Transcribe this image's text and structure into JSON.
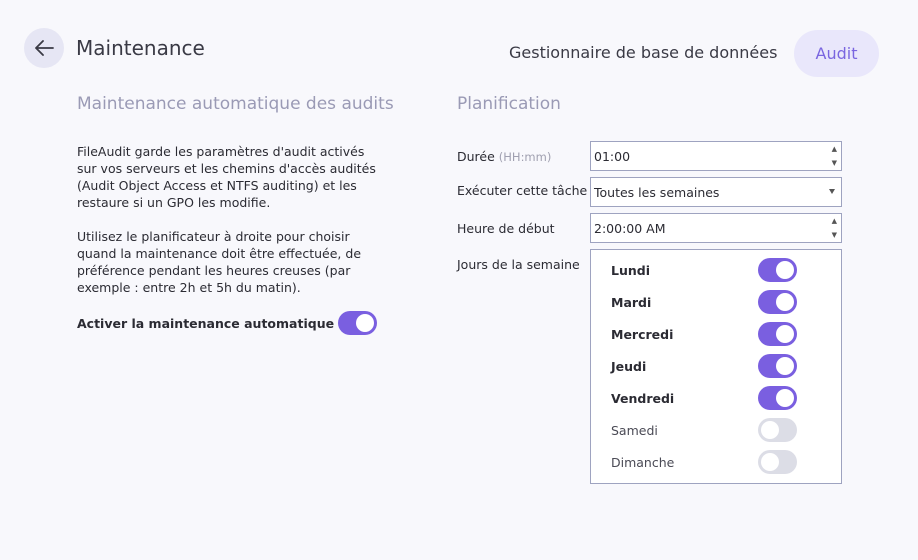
{
  "header": {
    "title": "Maintenance",
    "tabs": [
      {
        "label": "Gestionnaire de base de données",
        "active": false
      },
      {
        "label": "Audit",
        "active": true
      }
    ]
  },
  "left": {
    "title": "Maintenance automatique des audits",
    "paragraph1": "FileAudit garde les paramètres d'audit activés sur vos serveurs et les chemins d'accès audités (Audit Object Access et NTFS auditing) et les restaure si un GPO les modifie.",
    "paragraph2": "Utilisez le planificateur à droite pour choisir quand la maintenance doit être effectuée, de préférence pendant les heures creuses (par exemple : entre 2h et 5h du matin).",
    "auto_label": "Activer la maintenance automatique",
    "auto_enabled": true
  },
  "right": {
    "title": "Planification",
    "duration_label": "Durée",
    "duration_hint": "(HH:mm)",
    "duration_value": "01:00",
    "run_label": "Exécuter cette tâche",
    "run_value": "Toutes les semaines",
    "start_label": "Heure de début",
    "start_value": "2:00:00 AM",
    "days_label": "Jours de la semaine",
    "days": [
      {
        "label": "Lundi",
        "enabled": true
      },
      {
        "label": "Mardi",
        "enabled": true
      },
      {
        "label": "Mercredi",
        "enabled": true
      },
      {
        "label": "Jeudi",
        "enabled": true
      },
      {
        "label": "Vendredi",
        "enabled": true
      },
      {
        "label": "Samedi",
        "enabled": false
      },
      {
        "label": "Dimanche",
        "enabled": false
      }
    ]
  },
  "colors": {
    "accent": "#7a5fe0",
    "toggle_off": "#dcdde6",
    "section_title": "#9a9ab5",
    "audit_tab_bg": "#e9e7fb"
  },
  "icons": {
    "back": "arrow-left-icon",
    "spin_up": "caret-up-icon",
    "spin_down": "caret-down-icon",
    "dropdown": "caret-down-icon"
  }
}
